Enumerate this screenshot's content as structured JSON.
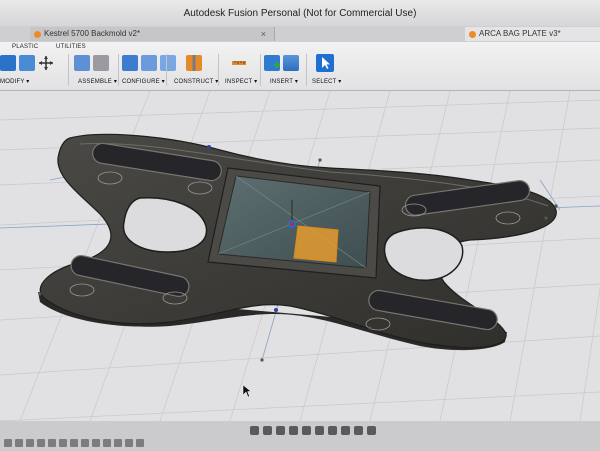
{
  "window": {
    "title": "Autodesk Fusion Personal (Not for Commercial Use)"
  },
  "tabs": [
    {
      "label": "Kestrel 5700 Backmold v2*",
      "active": false
    },
    {
      "label": "ARCA BAG PLATE v3*",
      "active": true
    }
  ],
  "workspace_tabs": {
    "plastic": "PLASTIC",
    "utilities": "UTILITIES"
  },
  "toolbar": {
    "modify": "MODIFY",
    "assemble": "ASSEMBLE",
    "configure": "CONFIGURE",
    "construct": "CONSTRUCT",
    "inspect": "INSPECT",
    "insert": "INSERT",
    "select": "SELECT"
  },
  "icons": {
    "tab_doc": "fusion-doc-icon",
    "modify": [
      "press-pull-icon",
      "fillet-icon",
      "move-icon"
    ],
    "assemble": [
      "new-component-icon",
      "joint-icon"
    ],
    "configure": [
      "configure-table-icon",
      "parameters-icon",
      "configure-icon"
    ],
    "construct": [
      "offset-plane-icon"
    ],
    "inspect": [
      "measure-icon"
    ],
    "insert": [
      "insert-mesh-icon",
      "insert-canvas-icon"
    ],
    "select": [
      "select-arrow-icon"
    ]
  },
  "colors": {
    "accent_orange": "#f08a24",
    "select_blue": "#1f6fd1",
    "plate_dark": "#3c3b38",
    "viewport_bg": "#e1e1e3",
    "grid_line": "#c8c8cc"
  }
}
